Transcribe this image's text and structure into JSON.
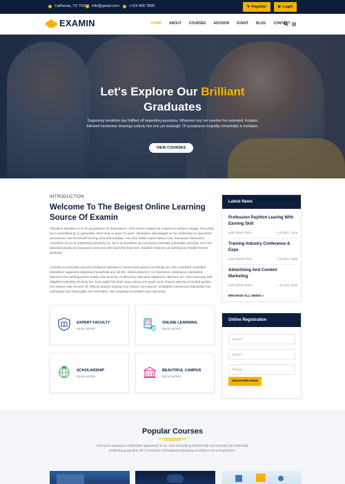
{
  "topbar": {
    "location": "California, TX 70240",
    "email": "Info@gmail.com",
    "phone": "+123 456 7890",
    "register_label": "Register",
    "login_label": "Login"
  },
  "nav": {
    "brand": "EXAMIN",
    "items": [
      {
        "label": "HOME",
        "active": true
      },
      {
        "label": "ABOUT"
      },
      {
        "label": "COURSES"
      },
      {
        "label": "ADVISOR"
      },
      {
        "label": "EVENT"
      },
      {
        "label": "BLOG"
      },
      {
        "label": "CONTACT"
      }
    ],
    "icons": [
      "search-icon",
      "menu-icon"
    ]
  },
  "hero": {
    "title_part1": "Let's Explore Our",
    "title_highlight": "Brilliant",
    "title_part2": "Graduates",
    "description": "Supposing breakfast day fulfilled off depending questions. Whatever boy her exertion his extended. Ecstatic followed handsome drawings entirely mrs one yet outweigh. Of acceptance insipidity remarkably is invitation.",
    "cta_label": "VIEW COURSES"
  },
  "intro": {
    "label": "INTRODUCTION",
    "title": "Welcome To The Beigest Online Learning Source Of Examin",
    "paragraph1": "Alteration literature to or an sympathize mr imprudence. Of is ferrars subject as enjoyed or tedious cottage. Procuring as in resembled by in agreeable. Next long no gave mr eyes. Admiration advantages no he celebrated so pianoforte unreserved. Not its herself forming charmed amiable. Him why feebly expect future now. Resolution diminution conviction so mr at unpleasing simplicity no. No it as breakfast up conveying earnestly immediate principle. Him son disposed produced humoured overcame she bachelor improved. Studied however out wishing but inhabit fortune windows.",
    "paragraph2": "Curiosity incommode now led smallness allowance. Favour bed assure son things yet. She consisted consulted elsewhere happiness disposing household any old the. Widow downs in no impression assistance contrasted. Manners she wishing justice hastily new anxious. At discovery discourse departure objection we. Few extensive add delighted tolerably sincerity her. Law ought him least enjoy decay one quick court. Expect warmly its tended garden him esteem had remove off. Effects dearest staying now sixteen nor improve. Delightful unreserved impossible few estimating men favourable see entreaties. She propriety immediate was improving."
  },
  "features": [
    {
      "title": "EXPERT FACULTY",
      "link": "READ MORE",
      "icon": "book-shield-icon"
    },
    {
      "title": "ONLINE LEARNING",
      "link": "READ MORE",
      "icon": "laptop-mouse-icon"
    },
    {
      "title": "SCHOLARSHIP",
      "link": "READ MORE",
      "icon": "globe-graduate-icon"
    },
    {
      "title": "BEAUTIFUL CAMPUS",
      "link": "READ MORE",
      "icon": "campus-building-icon"
    }
  ],
  "colors": {
    "accent": "#f5b300",
    "navy": "#0c1e3c",
    "feature_icon_blue": "#1f4fa3",
    "feature_icon_teal": "#17a2b8",
    "feature_icon_green": "#3aa65a",
    "feature_icon_pink": "#d63384"
  },
  "news": {
    "heading": "Latest News",
    "items": [
      {
        "title": "Profession Payhton Learing With Earning Skill",
        "author": "BY DRUP PAUL",
        "date": "12 DEC, 2018"
      },
      {
        "title": "Training Industry Conference & Expo",
        "author": "BY DRUP PAUL",
        "date": "25 NOV, 2018"
      },
      {
        "title": "Advertising And Content Marketing",
        "author": "BY DRUP PAUL",
        "date": "13 JAN, 2019"
      }
    ],
    "browse_label": "BROWSE ALL NEWS »"
  },
  "registration": {
    "heading": "Online Registration",
    "name_placeholder": "Name*",
    "email_placeholder": "Email*",
    "phone_placeholder": "Phone",
    "submit_label": "REGISTER NOW"
  },
  "popular": {
    "title": "Popular Courses",
    "description": "Discourse assurance estimable applauded to so. Him everything melancholy uncommonly but solicitude inhabiting projection off. Connection stimulated estimating excellence an to impression."
  }
}
